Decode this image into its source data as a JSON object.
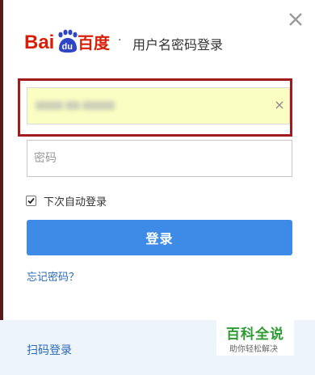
{
  "header": {
    "logo_text_left": "Bai",
    "logo_text_paw": "du",
    "logo_text_right": "百度",
    "separator": "·",
    "title": "用户名密码登录"
  },
  "close": {
    "symbol": "✕"
  },
  "username": {
    "clear_symbol": "×"
  },
  "password": {
    "placeholder": "密码"
  },
  "remember": {
    "label": "下次自动登录",
    "checked": true
  },
  "login": {
    "label": "登录"
  },
  "forgot": {
    "label": "忘记密码？"
  },
  "footer": {
    "qr_login_label": "扫码登录"
  },
  "watermark": {
    "title": "百科全说",
    "subtitle": "助你轻松解决"
  },
  "colors": {
    "brand_red": "#d81e06",
    "brand_blue": "#2e45c5",
    "button_blue": "#3e8be7",
    "link_blue": "#2a69b8",
    "highlight_border": "#a01c1c",
    "autofill_yellow": "#fbfec2"
  }
}
